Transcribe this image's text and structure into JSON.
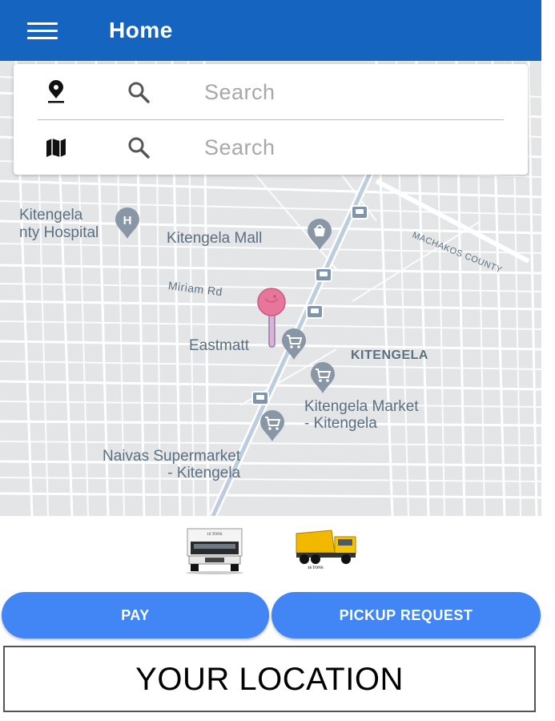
{
  "header": {
    "title": "Home",
    "menu_icon": "hamburger-menu-icon",
    "color": "#1565C0"
  },
  "search": {
    "origin": {
      "placeholder": "Search",
      "icon": "location-pin-icon"
    },
    "destination": {
      "placeholder": "Search",
      "icon": "map-icon"
    }
  },
  "map": {
    "labels": {
      "hospital": "Kitengela\nnty Hospital",
      "mall": "Kitengela Mall",
      "miriam_rd": "Miriam Rd",
      "machakos": "MACHAKOS COUNTY",
      "eastmatt": "Eastmatt",
      "kitengela": "KITENGELA",
      "market": "Kitengela Market\n- Kitengela",
      "naivas": "Naivas Supermarket\n- Kitengela"
    },
    "marker_color": "#e8769b"
  },
  "vehicles": {
    "truck_small_label": "16 TONS",
    "truck_large_label": "16 TONS"
  },
  "actions": {
    "pay_label": "PAY",
    "pickup_label": "PICKUP REQUEST",
    "button_color": "#4285F4"
  },
  "footer": {
    "location_label": "YOUR LOCATION"
  }
}
